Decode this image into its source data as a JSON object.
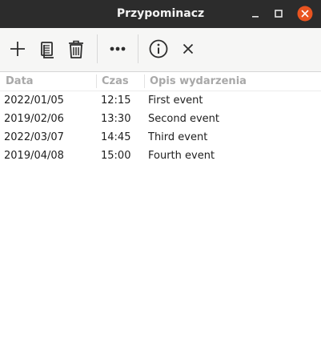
{
  "window": {
    "title": "Przypominacz",
    "accent_close": "#e95420"
  },
  "toolbar": {
    "buttons": [
      {
        "icon": "plus-icon"
      },
      {
        "icon": "copy-icon"
      },
      {
        "icon": "trash-icon"
      },
      {
        "icon": "more-icon"
      },
      {
        "icon": "info-icon"
      },
      {
        "icon": "close-icon"
      }
    ]
  },
  "table": {
    "headers": [
      "Data",
      "Czas",
      "Opis wydarzenia"
    ],
    "rows": [
      {
        "date": "2022/01/05",
        "time": "12:15",
        "desc": "First event"
      },
      {
        "date": "2019/02/06",
        "time": "13:30",
        "desc": "Second event"
      },
      {
        "date": "2022/03/07",
        "time": "14:45",
        "desc": "Third event"
      },
      {
        "date": "2019/04/08",
        "time": "15:00",
        "desc": "Fourth event"
      }
    ]
  }
}
